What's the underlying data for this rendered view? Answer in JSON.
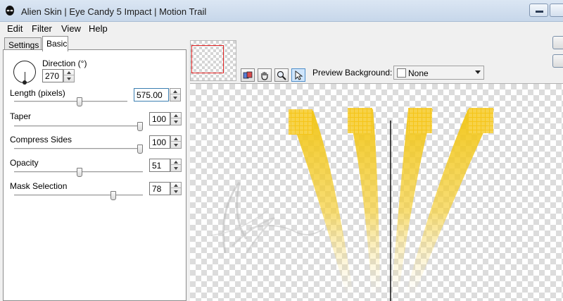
{
  "window": {
    "title": "Alien Skin | Eye Candy 5 Impact | Motion Trail",
    "app_icon": "alien-head-icon"
  },
  "menu": {
    "items": [
      {
        "label": "Edit"
      },
      {
        "label": "Filter"
      },
      {
        "label": "View"
      },
      {
        "label": "Help"
      }
    ]
  },
  "tabs": [
    {
      "label": "Settings",
      "active": false
    },
    {
      "label": "Basic",
      "active": true
    }
  ],
  "controls": {
    "direction": {
      "label": "Direction (°)",
      "value": "270"
    },
    "length": {
      "label": "Length (pixels)",
      "value": "575.00",
      "slider_fraction": 0.58
    },
    "taper": {
      "label": "Taper",
      "value": "100",
      "slider_fraction": 1.0
    },
    "compress_sides": {
      "label": "Compress Sides",
      "value": "100",
      "slider_fraction": 1.0
    },
    "opacity": {
      "label": "Opacity",
      "value": "51",
      "slider_fraction": 0.51
    },
    "mask_selection": {
      "label": "Mask Selection",
      "value": "78",
      "slider_fraction": 0.78
    }
  },
  "toolbar": {
    "tools": [
      {
        "name": "preview-compare-icon"
      },
      {
        "name": "hand-pan-icon"
      },
      {
        "name": "zoom-magnifier-icon"
      },
      {
        "name": "pointer-arrow-icon",
        "active": true
      }
    ],
    "preview_background_label": "Preview Background:",
    "preview_background_value": "None"
  },
  "colors": {
    "trail": "#f1c40f",
    "trail_light": "#f7dd6a",
    "selection_border": "#e02020"
  }
}
